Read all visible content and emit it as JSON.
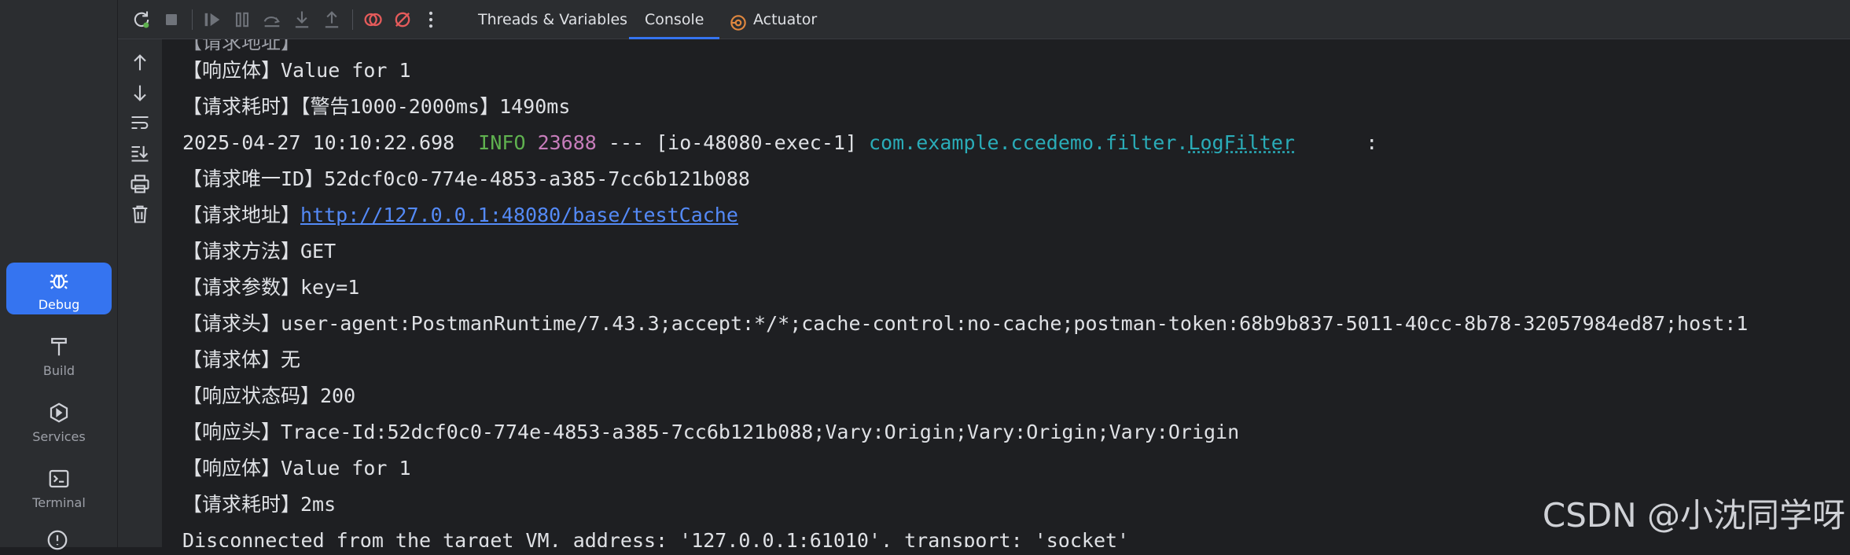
{
  "left_strip": {
    "debug_label": "Debug",
    "build_label": "Build",
    "services_label": "Services",
    "terminal_label": "Terminal"
  },
  "tabs": {
    "threads": "Threads & Variables",
    "console": "Console",
    "actuator": "Actuator"
  },
  "console_lines": {
    "l0": "【响应体】Value for 1",
    "l1": "【请求耗时】【警告1000-2000ms】1490ms",
    "l2_time": "2025-04-27 10:10:22.698  ",
    "l2_level": "INFO",
    "l2_pid": "23688",
    "l2_thread": " --- [io-48080-exec-1] ",
    "l2_pkg": "com.example.ccedemo.filter.",
    "l2_cls": "LogFilter",
    "l2_colon": "      :",
    "l3": "【请求唯一ID】52dcf0c0-774e-4853-a385-7cc6b121b088",
    "l4_label": "【请求地址】",
    "l4_url": "http://127.0.0.1:48080/base/testCache",
    "l5": "【请求方法】GET",
    "l6": "【请求参数】key=1",
    "l7": "【请求头】user-agent:PostmanRuntime/7.43.3;accept:*/*;cache-control:no-cache;postman-token:68b9b837-5011-40cc-8b78-32057984ed87;host:1",
    "l8": "【请求体】无",
    "l9": "【响应状态码】200",
    "l10": "【响应头】Trace-Id:52dcf0c0-774e-4853-a385-7cc6b121b088;Vary:Origin;Vary:Origin;Vary:Origin",
    "l11": "【响应体】Value for 1",
    "l12": "【请求耗时】2ms",
    "l13": "Disconnected from the target VM, address: '127.0.0.1:61010', transport: 'socket'"
  },
  "watermark": "CSDN @小沈同学呀",
  "colors": {
    "accent": "#3574f0",
    "info": "#5fb14f",
    "pid": "#c77dbb",
    "class": "#2aacb8",
    "link": "#548af7"
  },
  "icons": [
    "rerun-icon",
    "stop-icon",
    "resume-icon",
    "pause-icon",
    "step-over-icon",
    "step-into-icon",
    "step-out-icon",
    "breakpoints-icon",
    "mute-breakpoints-icon",
    "more-icon",
    "actuator-icon",
    "up-arrow-icon",
    "down-arrow-icon",
    "soft-wrap-icon",
    "scroll-to-end-icon",
    "print-icon",
    "trash-icon",
    "bug-icon",
    "hammer-icon",
    "services-icon",
    "terminal-icon"
  ]
}
